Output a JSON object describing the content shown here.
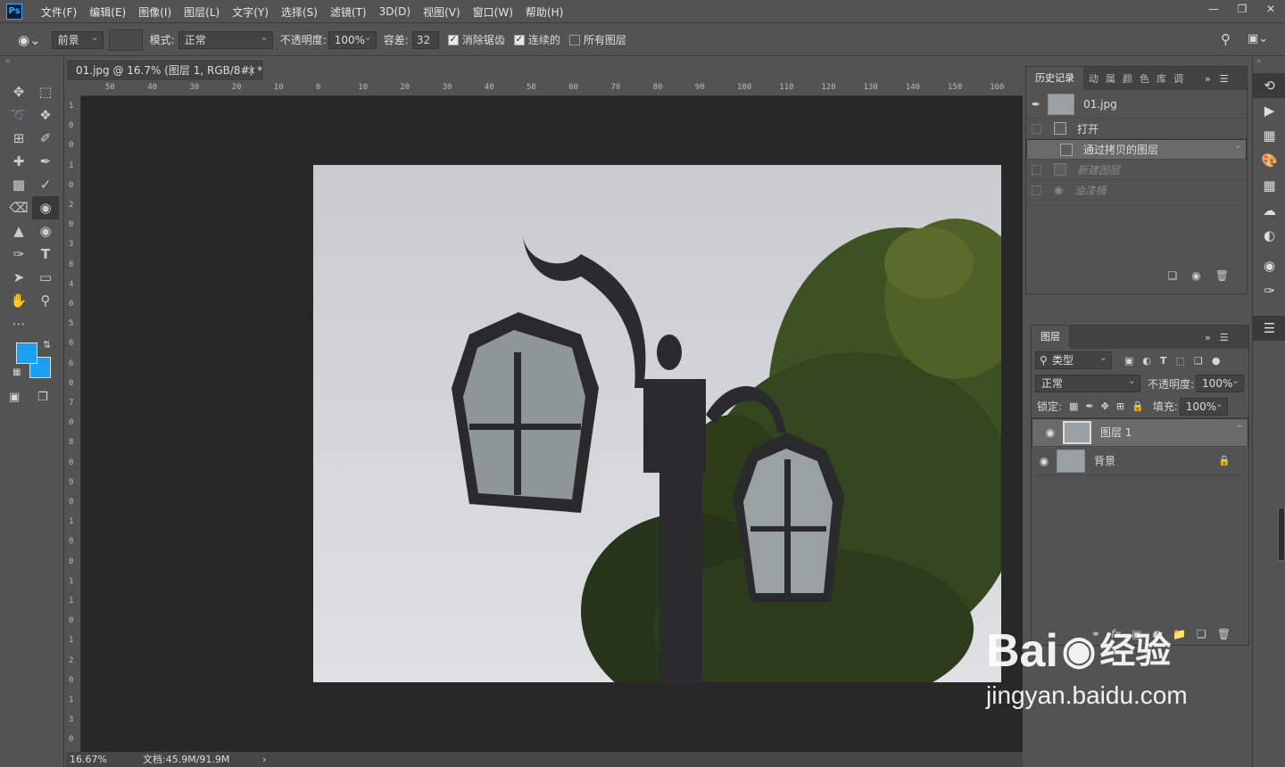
{
  "app": {
    "logo": "Ps"
  },
  "menu": [
    "文件(F)",
    "编辑(E)",
    "图像(I)",
    "图层(L)",
    "文字(Y)",
    "选择(S)",
    "滤镜(T)",
    "3D(D)",
    "视图(V)",
    "窗口(W)",
    "帮助(H)"
  ],
  "window_controls": [
    "minimize-icon",
    "restore-icon",
    "close-icon"
  ],
  "options": {
    "fill_source": "前景",
    "mode_label": "模式:",
    "mode_value": "正常",
    "opacity_label": "不透明度:",
    "opacity_value": "100%",
    "tolerance_label": "容差:",
    "tolerance_value": "32",
    "antialias_label": "消除锯齿",
    "antialias_checked": true,
    "contiguous_label": "连续的",
    "contiguous_checked": true,
    "all_layers_label": "所有图层",
    "all_layers_checked": false
  },
  "tools": [
    "move-tool",
    "marquee-tool",
    "lasso-tool",
    "quick-select-tool",
    "crop-tool",
    "eyedropper-tool",
    "healing-brush-tool",
    "brush-tool",
    "clone-stamp-tool",
    "history-brush-tool",
    "eraser-tool",
    "paint-bucket-tool",
    "blur-tool",
    "dodge-tool",
    "pen-tool",
    "type-tool",
    "path-select-tool",
    "rectangle-tool",
    "hand-tool",
    "zoom-tool"
  ],
  "colors": {
    "foreground": "#1ba0f0",
    "background": "#1ba0f0",
    "canvas": "#282828",
    "ui": "#535353"
  },
  "document": {
    "tab_title": "01.jpg @ 16.7% (图层 1, RGB/8#) *",
    "ruler_h": [
      "50",
      "40",
      "30",
      "20",
      "10",
      "0",
      "10",
      "20",
      "30",
      "40",
      "50",
      "60",
      "70",
      "80",
      "90",
      "100",
      "110",
      "120",
      "130",
      "140",
      "150",
      "160"
    ],
    "ruler_v": [
      "1",
      "0",
      "0",
      "1",
      "0",
      "2",
      "0",
      "3",
      "0",
      "4",
      "0",
      "5",
      "0",
      "6",
      "0",
      "7",
      "0",
      "8",
      "0",
      "9",
      "0",
      "1",
      "0",
      "0",
      "1",
      "1",
      "0",
      "1",
      "2",
      "0",
      "1",
      "3",
      "0"
    ],
    "zoom": "16.67%",
    "doc_size": "文档:45.9M/91.9M"
  },
  "history_panel": {
    "tabs": [
      "历史记录",
      "动",
      "属",
      "颜",
      "色",
      "库",
      "调"
    ],
    "snapshot": "01.jpg",
    "items": [
      {
        "label": "打开",
        "state": "normal"
      },
      {
        "label": "通过拷贝的图层",
        "state": "selected"
      },
      {
        "label": "新建图层",
        "state": "undone"
      },
      {
        "label": "油漆桶",
        "state": "undone"
      }
    ]
  },
  "layers_panel": {
    "tab": "图层",
    "filter_label": "类型",
    "blend_mode": "正常",
    "opacity_label": "不透明度:",
    "opacity_value": "100%",
    "lock_label": "锁定:",
    "fill_label": "填充:",
    "fill_value": "100%",
    "layers": [
      {
        "name": "图层 1",
        "selected": true,
        "locked": false
      },
      {
        "name": "背景",
        "selected": false,
        "locked": true
      }
    ]
  },
  "watermark": {
    "brand": "Bai",
    "brand_cn": "经验",
    "url": "jingyan.baidu.com"
  }
}
